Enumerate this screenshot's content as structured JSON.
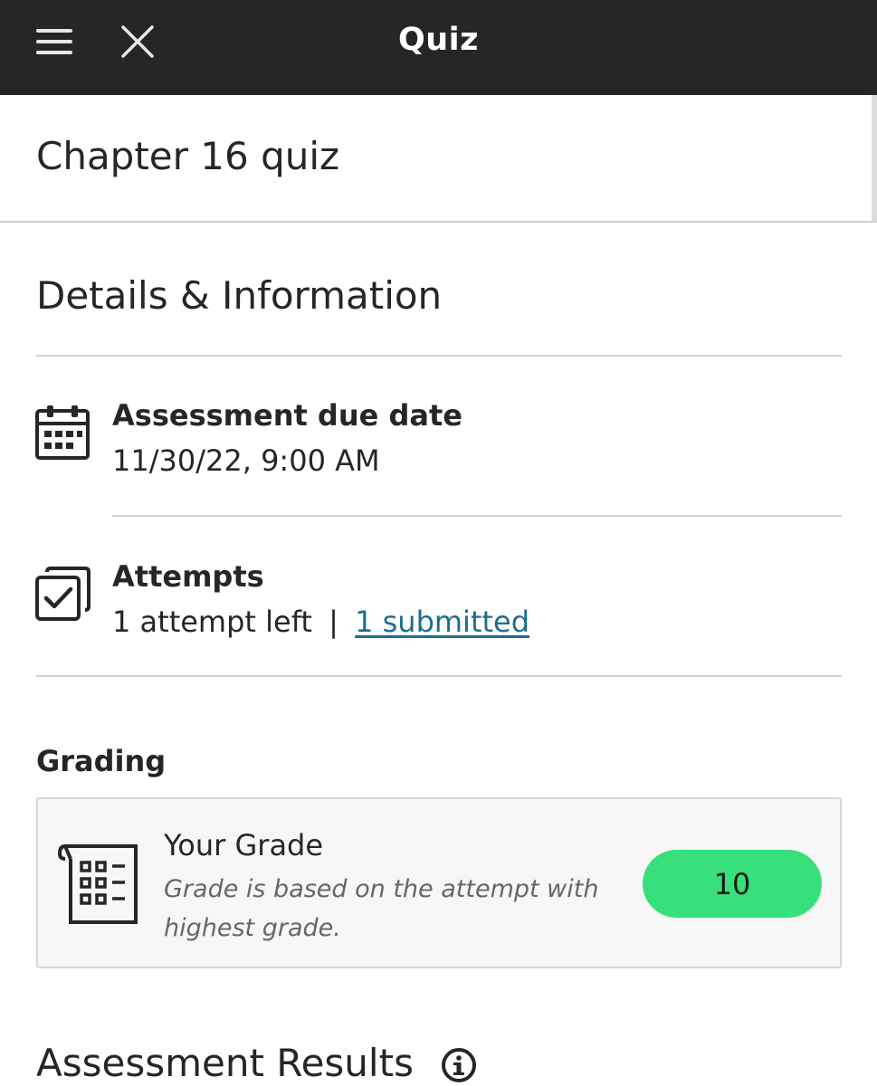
{
  "header": {
    "title": "Quiz"
  },
  "item": {
    "title": "Chapter 16 quiz"
  },
  "details": {
    "heading": "Details & Information",
    "due_date": {
      "label": "Assessment due date",
      "value": "11/30/22, 9:00 AM"
    },
    "attempts": {
      "label": "Attempts",
      "left": "1 attempt left",
      "separator": "|",
      "submitted_link": "1 submitted"
    }
  },
  "grading": {
    "heading": "Grading",
    "card": {
      "title": "Your Grade",
      "note": "Grade is based on the attempt with highest grade.",
      "grade_value": "10"
    }
  },
  "results": {
    "heading": "Assessment Results"
  },
  "colors": {
    "topbar": "#262626",
    "link": "#1c6e8d",
    "grade_pill": "#38e07c"
  },
  "icons": {
    "menu": "hamburger-menu-icon",
    "close": "close-icon",
    "due_date": "calendar-icon",
    "attempts": "checkbox-stack-icon",
    "grade": "gradebook-icon",
    "info": "info-icon"
  }
}
